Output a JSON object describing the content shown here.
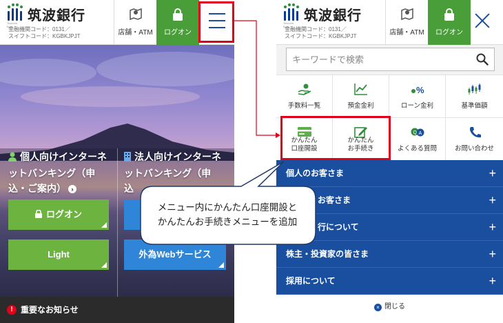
{
  "brand": {
    "name": "筑波銀行",
    "tiny": "Tsukuba Bank",
    "code_line1": "金融機関コード：0131／",
    "code_line2": "スイフトコード：KGBKJPJT",
    "green": "#4a9e3a",
    "navy": "#1a4fa0"
  },
  "header": {
    "store_label": "店舗・ATM",
    "logon_label": "ログオン",
    "store_icon": "map-pin-icon",
    "logon_icon": "lock-icon",
    "menu_icon": "hamburger-icon",
    "close_icon": "close-icon"
  },
  "left": {
    "personal_title_1": "個人向けインターネ",
    "personal_title_2": "ットバンキング（申",
    "personal_title_3": "込・ご案内）",
    "corporate_title_1": "法人向けインターネ",
    "corporate_title_2": "ットバンキング（申",
    "corporate_title_3": "込",
    "logon_button": "ログオン",
    "light_button": "Light",
    "foreign_button": "外為Webサービス",
    "notice": "重要なお知らせ",
    "accent_red": "#e0001a"
  },
  "search": {
    "placeholder": "キーワードで検索",
    "icon": "search-icon"
  },
  "quick_menu": [
    {
      "label": "手数料一覧",
      "icon": "fee-hand-icon"
    },
    {
      "label": "預金金利",
      "icon": "line-chart-icon"
    },
    {
      "label": "ローン金利",
      "icon": "percent-icon"
    },
    {
      "label": "基準価額",
      "icon": "candlestick-icon"
    },
    {
      "label_1": "かんたん",
      "label_2": "口座開設",
      "icon": "bank-card-icon"
    },
    {
      "label_1": "かんたん",
      "label_2": "お手続き",
      "icon": "edit-form-icon"
    },
    {
      "label": "よくある質問",
      "icon": "faq-bubble-icon"
    },
    {
      "label": "お問い合わせ",
      "icon": "phone-icon"
    }
  ],
  "accordion": [
    {
      "label": "個人のお客さま"
    },
    {
      "label": "法人のお客さま"
    },
    {
      "label": "筑波銀行について"
    },
    {
      "label": "株主・投資家の皆さま"
    },
    {
      "label": "採用について"
    }
  ],
  "accordion_visible": {
    "row2": "お客さま",
    "row3": "行について"
  },
  "close_label": "閉じる",
  "callout": {
    "line1": "メニュー内にかんたん口座開設と",
    "line2": "かんたんお手続きメニューを追加"
  }
}
